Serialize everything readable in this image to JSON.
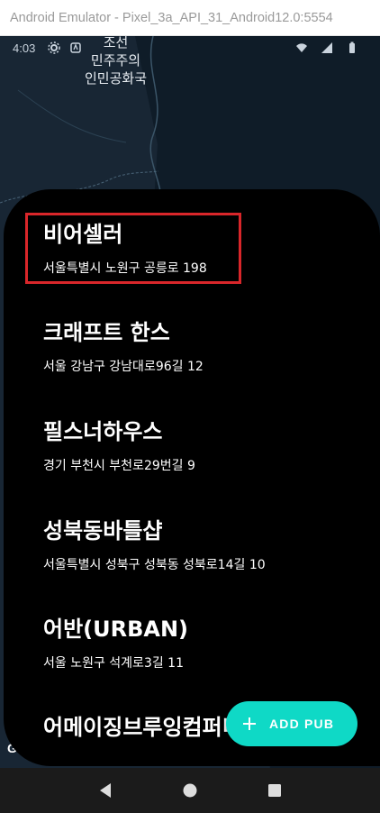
{
  "window": {
    "title": "Android Emulator - Pixel_3a_API_31_Android12.0:5554"
  },
  "status_bar": {
    "time": "4:03"
  },
  "map": {
    "label_lines": [
      "조선",
      "민주주의",
      "인민공화국"
    ],
    "attribution": "G"
  },
  "pubs": [
    {
      "name": "비어셀러",
      "address": "서울특별시 노원구 공릉로 198"
    },
    {
      "name": "크래프트 한스",
      "address": "서울 강남구 강남대로96길 12"
    },
    {
      "name": "필스너하우스",
      "address": "경기 부천시 부천로29번길 9"
    },
    {
      "name": "성북동바틀샵",
      "address": "서울특별시 성북구 성북동 성북로14길 10"
    },
    {
      "name": "어반(URBAN)",
      "address": "서울 노원구 석계로3길 11"
    },
    {
      "name": "어메이징브루잉컴퍼니",
      "address": ""
    }
  ],
  "fab": {
    "label": "ADD PUB",
    "icon": "plus-icon"
  },
  "colors": {
    "accent": "#0fd9c6",
    "highlight": "#d9262a",
    "sheet": "#000000",
    "map": "#182634"
  },
  "nav": {
    "icons": [
      "back-icon",
      "home-icon",
      "recents-icon"
    ]
  }
}
